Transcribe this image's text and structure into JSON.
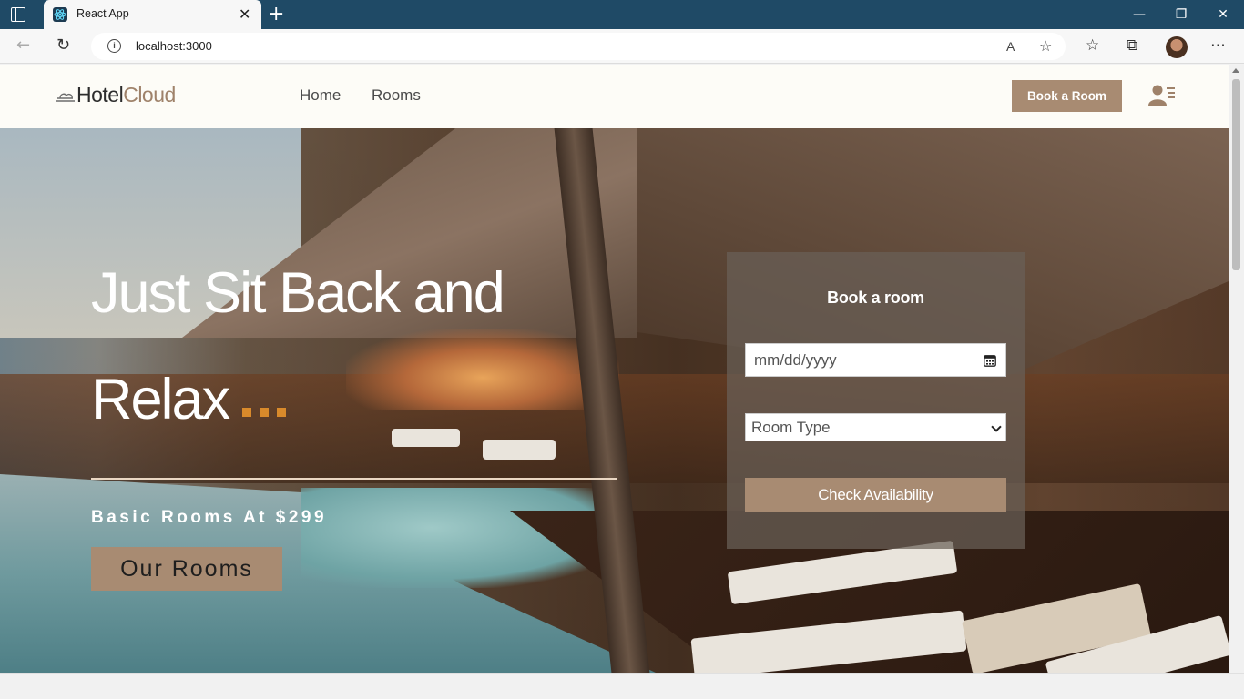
{
  "browser": {
    "tab_title": "React App",
    "tab_close": "✕",
    "new_tab": "+",
    "url": "localhost:3000",
    "window_controls": {
      "minimize": "—",
      "restore": "❐",
      "close": "✕"
    }
  },
  "nav": {
    "logo_part1": "Hotel",
    "logo_part2": "Cloud",
    "links": [
      "Home",
      "Rooms"
    ],
    "book_button": "Book a Room",
    "user_icon": "user-menu-icon"
  },
  "hero": {
    "title_line1": "Just Sit Back and",
    "title_line2": "Relax",
    "subtitle": "Basic Rooms At $299",
    "cta": "Our Rooms"
  },
  "booking": {
    "title": "Book a room",
    "date_placeholder": "mm/dd/yyyy",
    "room_type": "Room Type",
    "submit": "Check Availability"
  },
  "colors": {
    "accent": "#a88b72",
    "browser_chrome": "#1f4a66",
    "dots": "#d98a2b"
  }
}
